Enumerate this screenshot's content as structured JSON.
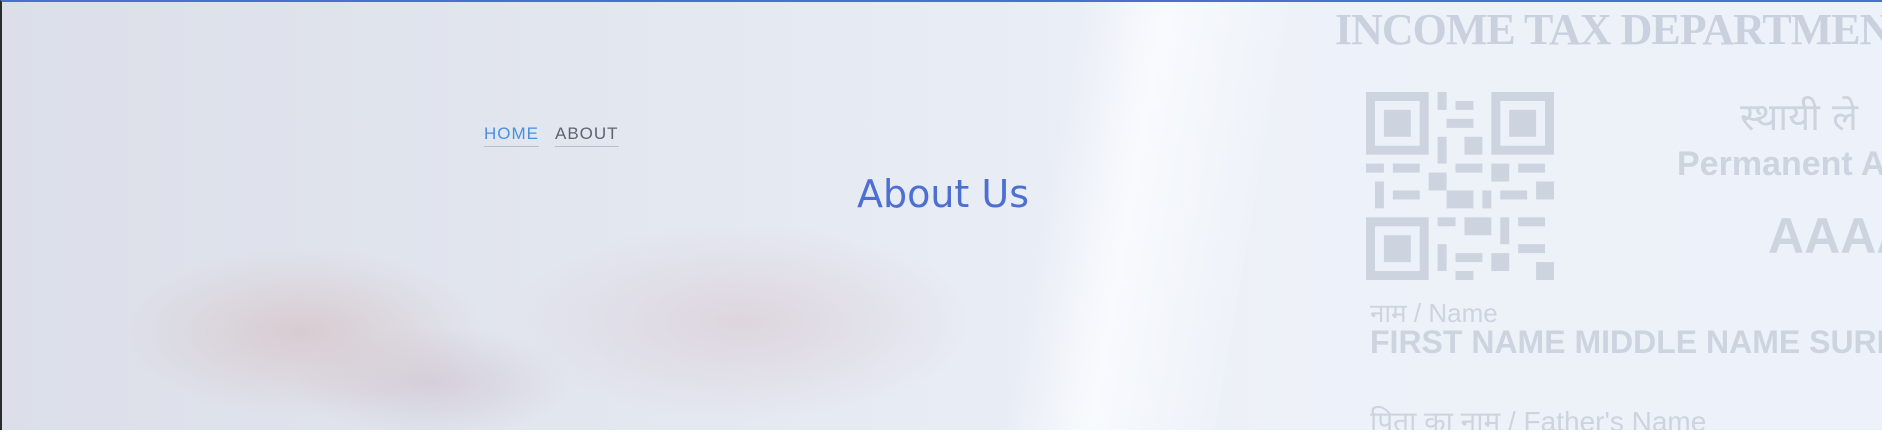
{
  "breadcrumb": {
    "home": "HOME",
    "about": "ABOUT"
  },
  "page_title": "About Us",
  "background": {
    "pan_card": {
      "department": "INCOME TAX DEPARTMENT",
      "hindi_heading": "स्थायी ले",
      "permanent_account": "Permanent Ac",
      "number": "AAAA",
      "name_label": "नाम / Name",
      "name_value": "FIRST NAME  MIDDLE NAME  SURNA",
      "father_label": "पिता का नाम / Father's Name"
    }
  },
  "colors": {
    "accent": "#4e6fd2",
    "breadcrumb_active": "#4a8fe0",
    "breadcrumb_text": "#5d6470",
    "top_border": "#4a6fd0"
  }
}
